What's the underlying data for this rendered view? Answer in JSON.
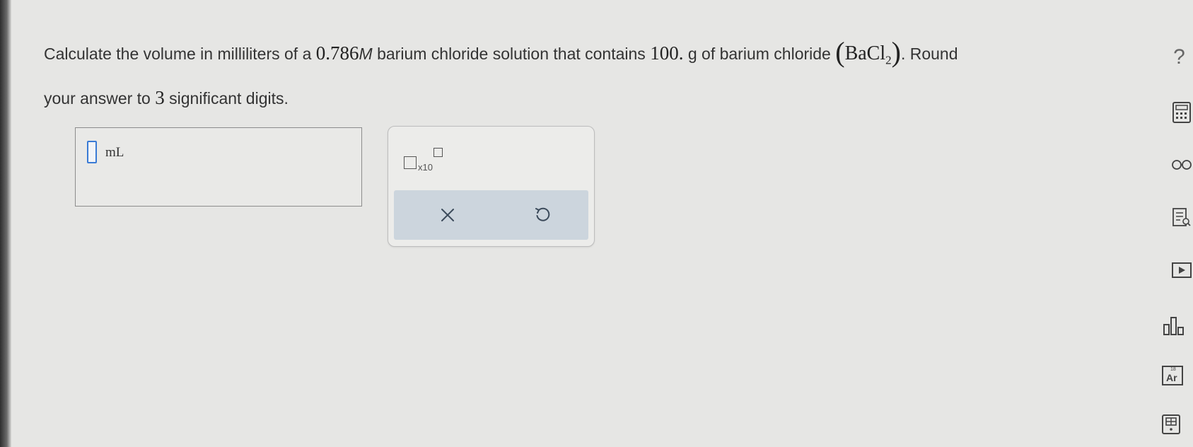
{
  "question": {
    "part1": "Calculate the volume in milliliters of a ",
    "concentration_value": "0.786",
    "concentration_unit": "M",
    "part2": " barium chloride solution that contains ",
    "mass_value": "100.",
    "part3": " g of barium chloride ",
    "formula_main": "BaCl",
    "formula_sub": "2",
    "part4": ". Round",
    "part5": "your answer to ",
    "sig_digits": "3",
    "part6": " significant digits."
  },
  "answer": {
    "unit": "mL"
  },
  "tools": {
    "sci_multiplier": "x10"
  },
  "sidebar": {
    "help_label": "?",
    "periodic_label": "Ar",
    "periodic_number": "18"
  },
  "colors": {
    "background": "#e6e6e4",
    "accent": "#3a7bd5",
    "action_bar": "#ccd5dd"
  }
}
